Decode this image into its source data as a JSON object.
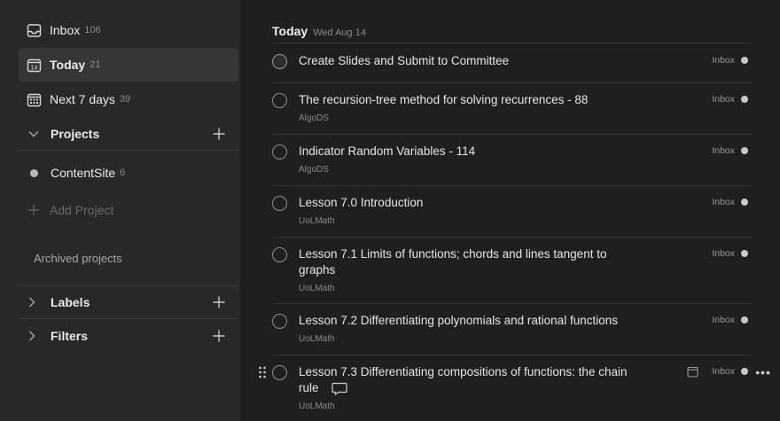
{
  "sidebar": {
    "nav": [
      {
        "label": "Inbox",
        "count": "106",
        "icon": "inbox-icon"
      },
      {
        "label": "Today",
        "count": "21",
        "icon": "calendar-today-icon",
        "today_num": "14"
      },
      {
        "label": "Next 7 days",
        "count": "39",
        "icon": "calendar-week-icon"
      }
    ],
    "projects_header": "Projects",
    "projects": [
      {
        "label": "ContentSite",
        "count": "6"
      }
    ],
    "add_project": "Add Project",
    "archived": "Archived projects",
    "labels_header": "Labels",
    "filters_header": "Filters"
  },
  "main": {
    "title": "Today",
    "date": "Wed Aug 14",
    "tasks": [
      {
        "title": "Create Slides and Submit to Committee",
        "sub": "",
        "project": "Inbox"
      },
      {
        "title": "The recursion-tree method for solving recurrences - 88",
        "sub": "AlgoDS",
        "project": "Inbox"
      },
      {
        "title": "Indicator Random Variables - 114",
        "sub": "AlgoDS",
        "project": "Inbox"
      },
      {
        "title": "Lesson 7.0 Introduction",
        "sub": "UoLMath",
        "project": "Inbox"
      },
      {
        "title": "Lesson 7.1 Limits of functions; chords and lines tangent to graphs",
        "sub": "UoLMath",
        "project": "Inbox"
      },
      {
        "title": "Lesson 7.2 Differentiating polynomials and rational functions",
        "sub": "UoLMath",
        "project": "Inbox"
      },
      {
        "title": "Lesson 7.3 Differentiating compositions of functions: the chain rule",
        "sub": "UoLMath",
        "project": "Inbox"
      }
    ],
    "more": "•••"
  },
  "colors": {
    "sidebar_bg": "#282828",
    "main_bg": "#1f1f1f",
    "active_bg": "#363636"
  }
}
